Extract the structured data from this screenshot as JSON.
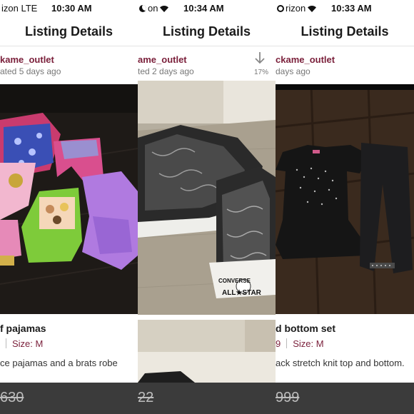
{
  "panels": [
    {
      "status": {
        "carrier": "izon  LTE",
        "time": "10:30 AM"
      },
      "nav_title": "Listing Details",
      "seller": "kame_outlet",
      "updated": "ated 5 days ago",
      "product_title": "f pajamas",
      "size_label": "Size: M",
      "description": "ce pajamas and a brats robe",
      "price": "630"
    },
    {
      "status": {
        "carrier": "on",
        "time": "10:34 AM"
      },
      "nav_title": "Listing Details",
      "seller": "ame_outlet",
      "updated": "ted 2 days ago",
      "share_percent": "17%",
      "price": "22"
    },
    {
      "status": {
        "carrier": "rizon",
        "time": "10:33 AM"
      },
      "nav_title": "Listing Details",
      "seller": "ckame_outlet",
      "updated": "days ago",
      "product_title": "d bottom set",
      "size_prefix": "9",
      "size_label": "Size: M",
      "description": "ack stretch knit top and bottom.",
      "price": "999"
    }
  ],
  "colors": {
    "seller": "#7a1f3a",
    "bottom_bar": "#3b3b3b"
  }
}
